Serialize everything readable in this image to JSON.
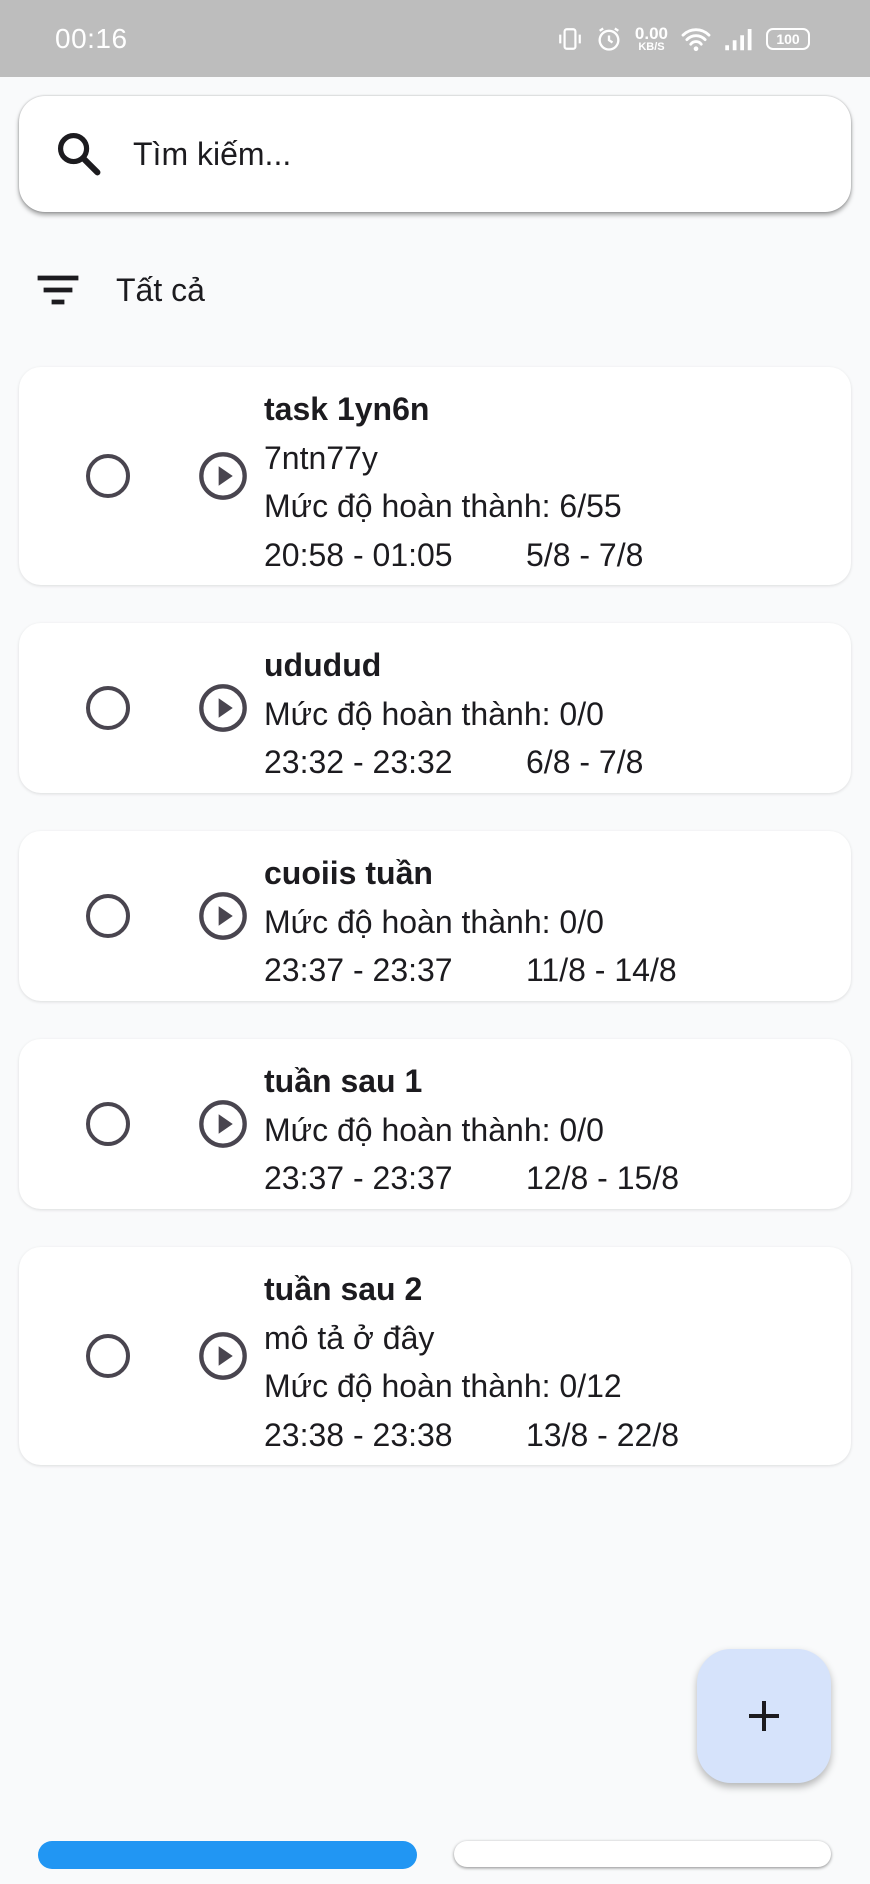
{
  "status_bar": {
    "time": "00:16",
    "net_speed_value": "0.00",
    "net_speed_unit": "KB/S",
    "battery": "100",
    "icons": [
      "vibrate-icon",
      "alarm-icon",
      "wifi-icon",
      "signal-icon",
      "battery-icon"
    ]
  },
  "search": {
    "placeholder": "Tìm kiếm...",
    "value": "",
    "icon": "search-icon"
  },
  "filter": {
    "icon": "filter-icon",
    "label": "Tất cả"
  },
  "tasks": [
    {
      "title": "task 1yn6n",
      "description": "7ntn77y",
      "progress": "Mức độ hoàn thành: 6/55",
      "time": "20:58 - 01:05",
      "dates": "5/8 - 7/8"
    },
    {
      "title": "ududud",
      "progress": "Mức độ hoàn thành: 0/0",
      "time": "23:32 - 23:32",
      "dates": "6/8 - 7/8"
    },
    {
      "title": "cuoiis tuần",
      "progress": "Mức độ hoàn thành: 0/0",
      "time": "23:37 - 23:37",
      "dates": "11/8 - 14/8"
    },
    {
      "title": "tuần sau 1",
      "progress": "Mức độ hoàn thành: 0/0",
      "time": "23:37 - 23:37",
      "dates": "12/8 - 15/8"
    },
    {
      "title": "tuần sau 2",
      "description": "mô tả ở đây",
      "progress": "Mức độ hoàn thành: 0/12",
      "time": "23:38 - 23:38",
      "dates": "13/8 - 22/8"
    }
  ],
  "fab": {
    "icon": "plus-icon"
  },
  "bottom_nav": {
    "active_color": "#2196f3",
    "items": [
      "nav-tab-1",
      "nav-tab-2"
    ]
  },
  "colors": {
    "status_bar": "#bdbdbd",
    "background": "#f9fafb",
    "fab": "#d6e3fb",
    "icon": "#49454f"
  }
}
